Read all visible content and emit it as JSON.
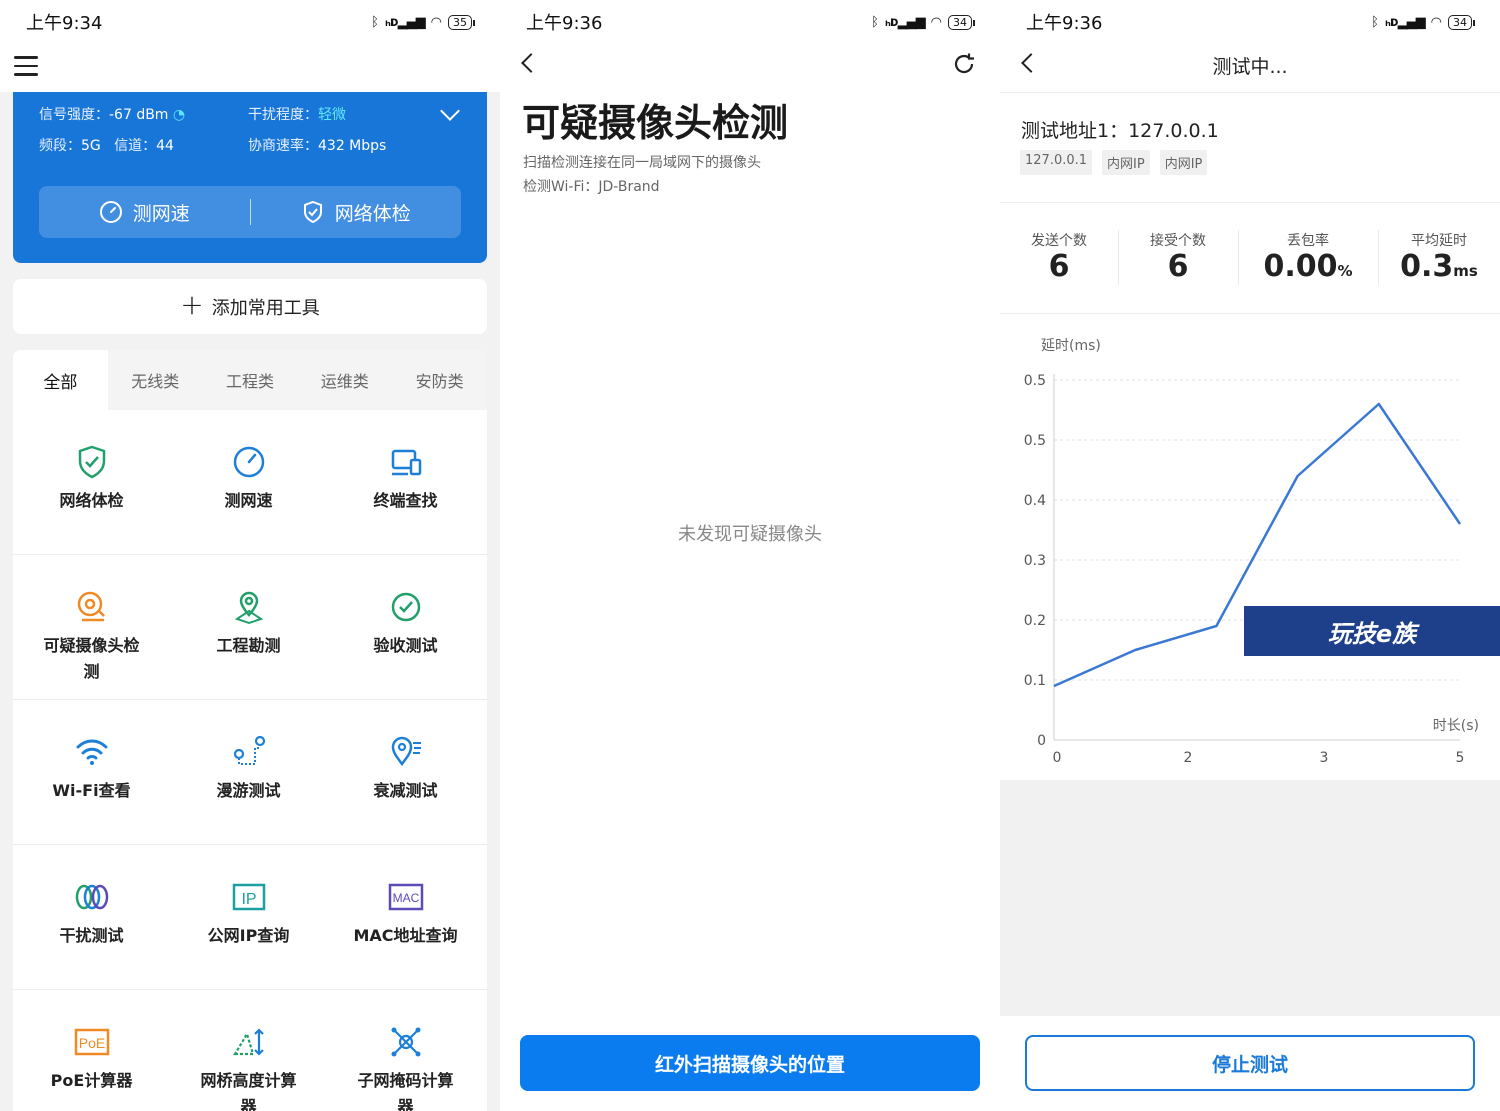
{
  "panel1": {
    "status": {
      "time": "上午9:34",
      "battery": "35"
    },
    "wifi_info": {
      "signal_label": "信号强度：",
      "signal_value": "-67 dBm",
      "interference_label": "干扰程度：",
      "interference_value": "轻微",
      "band_label": "频段：",
      "band_value": "5G",
      "channel_label": "信道：",
      "channel_value": "44",
      "rate_label": "协商速率：",
      "rate_value": "432 Mbps"
    },
    "quick_buttons": {
      "speed": "测网速",
      "checkup": "网络体检"
    },
    "add_tool": "添加常用工具",
    "tabs": [
      "全部",
      "无线类",
      "工程类",
      "运维类",
      "安防类"
    ],
    "tools": [
      {
        "label": "网络体检",
        "icon": "shield-check-icon"
      },
      {
        "label": "测网速",
        "icon": "speedometer-icon"
      },
      {
        "label": "终端查找",
        "icon": "devices-icon"
      },
      {
        "label": "可疑摄像头检测",
        "icon": "camera-detect-icon"
      },
      {
        "label": "工程勘测",
        "icon": "location-pin-icon"
      },
      {
        "label": "验收测试",
        "icon": "check-circle-icon"
      },
      {
        "label": "Wi-Fi查看",
        "icon": "wifi-icon"
      },
      {
        "label": "漫游测试",
        "icon": "roaming-icon"
      },
      {
        "label": "衰减测试",
        "icon": "attenuation-icon"
      },
      {
        "label": "干扰测试",
        "icon": "interference-rings-icon"
      },
      {
        "label": "公网IP查询",
        "icon": "ip-icon"
      },
      {
        "label": "MAC地址查询",
        "icon": "mac-icon"
      },
      {
        "label": "PoE计算器",
        "icon": "poe-icon"
      },
      {
        "label": "网桥高度计算器",
        "icon": "bridge-height-icon"
      },
      {
        "label": "子网掩码计算器",
        "icon": "subnet-icon"
      }
    ],
    "colors": {
      "blue_card": "#1976d9",
      "green": "#22a06b",
      "blue": "#1e7fd8",
      "orange": "#f08a24",
      "purple": "#5b4bb7"
    }
  },
  "panel2": {
    "status": {
      "time": "上午9:36",
      "battery": "34"
    },
    "title": "可疑摄像头检测",
    "subtitle": "扫描检测连接在同一局域网下的摄像头",
    "wifi_line": "检测Wi-Fi：JD-Brand",
    "empty_text": "未发现可疑摄像头",
    "action_button": "红外扫描摄像头的位置"
  },
  "panel3": {
    "status": {
      "time": "上午9:36",
      "battery": "34"
    },
    "title": "测试中...",
    "address_line": "测试地址1：127.0.0.1",
    "chips": [
      "127.0.0.1",
      "内网IP",
      "内网IP"
    ],
    "stats": [
      {
        "key": "发送个数",
        "value": "6",
        "unit": ""
      },
      {
        "key": "接受个数",
        "value": "6",
        "unit": ""
      },
      {
        "key": "丢包率",
        "value": "0.00",
        "unit": "%"
      },
      {
        "key": "平均延时",
        "value": "0.3",
        "unit": "ms"
      }
    ],
    "stop_button": "停止测试",
    "watermark": "玩技e族"
  },
  "chart_data": {
    "type": "line",
    "title": "",
    "ylabel": "延时(ms)",
    "xlabel": "时长(s)",
    "x_ticks": [
      "0",
      "2",
      "3",
      "5"
    ],
    "y_ticks": [
      "0",
      "0.1",
      "0.2",
      "0.3",
      "0.4",
      "0.5",
      "0.5"
    ],
    "x": [
      0,
      1,
      2,
      3,
      4,
      5
    ],
    "series": [
      {
        "values": [
          0.09,
          0.15,
          0.19,
          0.44,
          0.56,
          0.36
        ]
      }
    ],
    "ylim": [
      0,
      0.6
    ],
    "color": "#3a78d4",
    "grid": true
  }
}
